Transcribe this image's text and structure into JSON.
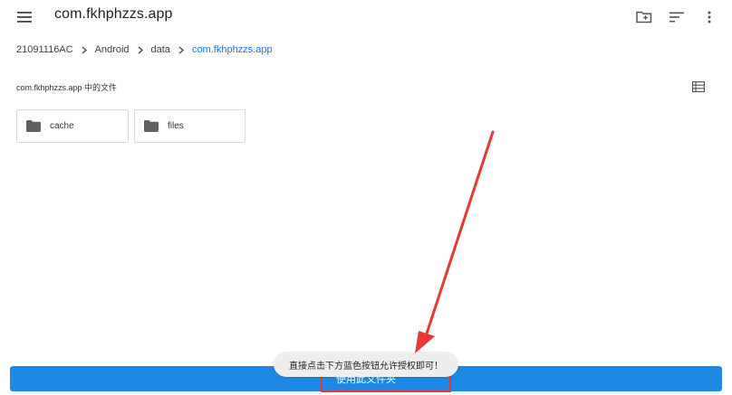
{
  "app_bar": {
    "title": "com.fkhphzzs.app",
    "menu_icon": "menu-icon",
    "actions": [
      "new-folder-icon",
      "sort-icon",
      "more-vert-icon"
    ]
  },
  "breadcrumb": {
    "items": [
      "21091116AC",
      "Android",
      "data",
      "com.fkhphzzs.app"
    ],
    "separator_icon": "chevron-right-icon"
  },
  "section": {
    "title": "com.fkhphzzs.app 中的文件",
    "view_icon": "list-view-icon"
  },
  "folders": [
    {
      "name": "cache",
      "icon": "folder-icon"
    },
    {
      "name": "files",
      "icon": "folder-icon"
    }
  ],
  "toast": {
    "text": "直接点击下方蓝色按钮允许授权即可！"
  },
  "bottom_button": {
    "label": "使用此文件夹"
  },
  "colors": {
    "accent": "#1e88e5",
    "breadcrumb_current": "#1a73e8",
    "annotation": "#e53935",
    "toast_bg": "#eeeeee"
  }
}
